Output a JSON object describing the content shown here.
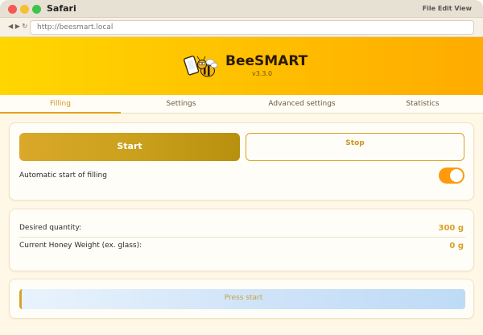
{
  "window": {
    "app_name": "Safari",
    "menus": "File Edit View",
    "nav_buttons": "◀ ▶ ↻"
  },
  "browser": {
    "url": "http://beesmart.local"
  },
  "header": {
    "brand": "BeeSMART",
    "version": "v3.3.0",
    "logo_icon": "bee-phone-logo-icon"
  },
  "tabs": [
    {
      "label": "Filling",
      "active": true
    },
    {
      "label": "Settings",
      "active": false
    },
    {
      "label": "Advanced settings",
      "active": false
    },
    {
      "label": "Statistics",
      "active": false
    }
  ],
  "controls": {
    "start_label": "Start",
    "stop_label": "Stop",
    "auto_start_label": "Automatic start of filling",
    "auto_start_enabled": true
  },
  "measurements": {
    "desired_label": "Desired quantity:",
    "desired_value": "300 g",
    "current_label": "Current Honey Weight (ex. glass):",
    "current_value": "0 g"
  },
  "progress": {
    "text": "Press start",
    "fraction": 0
  },
  "colors": {
    "accent": "#d9a326",
    "toggle_on": "#ff9a0d",
    "header_start": "#ffd600",
    "header_end": "#ffab00"
  }
}
